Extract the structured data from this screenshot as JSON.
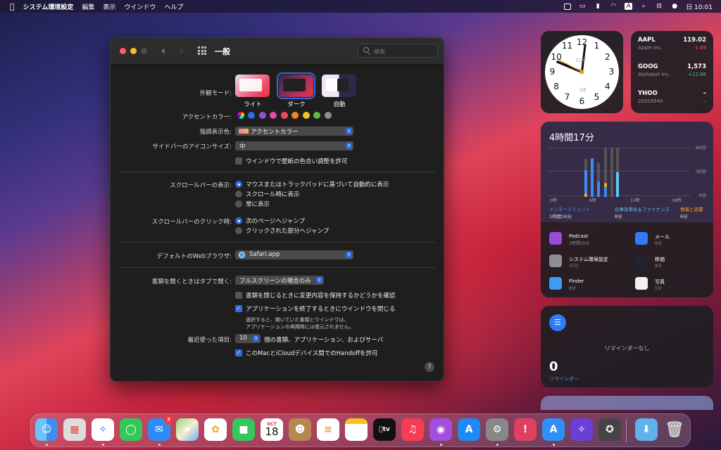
{
  "menubar": {
    "app": "システム環境設定",
    "items": [
      "編集",
      "表示",
      "ウインドウ",
      "ヘルプ"
    ],
    "clock": "日 10:01",
    "input_indicator": "A"
  },
  "window": {
    "title": "一般",
    "search_placeholder": "検索",
    "appearance": {
      "label": "外観モード:",
      "options": [
        "ライト",
        "ダーク",
        "自動"
      ],
      "selected": "ダーク"
    },
    "accent": {
      "label": "アクセントカラー:",
      "colors": [
        "#2f6ae0",
        "#8c4fd6",
        "#e04fa0",
        "#ef4a55",
        "#f3832b",
        "#f5c21b",
        "#5dbb3f",
        "#8e8e8e"
      ]
    },
    "highlight": {
      "label": "強調表示色:",
      "value": "アクセントカラー"
    },
    "sidebar_icon": {
      "label": "サイドバーのアイコンサイズ:",
      "value": "中"
    },
    "tint_checkbox": "ウインドウで壁紙の色合い調整を許可",
    "scrollbar": {
      "label": "スクロールバーの表示:",
      "options": [
        "マウスまたはトラックパッドに基づいて自動的に表示",
        "スクロール時に表示",
        "常に表示"
      ]
    },
    "scroll_click": {
      "label": "スクロールバーのクリック時:",
      "options": [
        "次のページへジャンプ",
        "クリックされた部分へジャンプ"
      ]
    },
    "browser": {
      "label": "デフォルトのWebブラウザ:",
      "value": "Safari.app"
    },
    "tabs": {
      "label": "書類を開くときはタブで開く:",
      "value": "フルスクリーンの場合のみ"
    },
    "ask_keep": "書類を閉じるときに変更内容を保持するかどうかを確認",
    "close_windows": "アプリケーションを終了するときにウインドウを閉じる",
    "close_note": [
      "選択すると、開いていた書類とウインドウは、",
      "アプリケーションの再開時には復元されません。"
    ],
    "recent": {
      "label": "最近使った項目:",
      "value": "10",
      "suffix": "個の書類、アプリケーション、およびサーバ"
    },
    "handoff": "このMacとiCloudデバイス間でのHandoffを許可",
    "help": "?"
  },
  "clock_widget": {
    "numbers": [
      "12",
      "1",
      "2",
      "3",
      "4",
      "5",
      "6",
      "7",
      "8",
      "9",
      "10",
      "11"
    ],
    "city": "CUP",
    "offset": "-16",
    "time": "10:01"
  },
  "stocks": [
    {
      "symbol": "AAPL",
      "name": "Apple Inc.",
      "price": "119.02",
      "change": "-1.69",
      "color": "#ff453a"
    },
    {
      "symbol": "GOOG",
      "name": "Alphabet Inc.",
      "price": "1,573",
      "change": "+13.88",
      "color": "#30d158"
    },
    {
      "symbol": "YHOO",
      "name": "20318540",
      "price": "–",
      "change": "–",
      "color": "#999999"
    }
  ],
  "screentime": {
    "total": "4時間17分",
    "yaxis": [
      "60分",
      "30分",
      "0分"
    ],
    "xaxis": [
      "0時",
      "6時",
      "12時",
      "18時"
    ],
    "categories": [
      {
        "name": "エンターテイメント",
        "time": "1時間16分",
        "color": "#3d8cf5"
      },
      {
        "name": "仕事効率化＆ファイナンス",
        "time": "8分",
        "color": "#5bc8f5"
      },
      {
        "name": "情報と読書",
        "time": "6分",
        "color": "#f5a623"
      }
    ],
    "apps": [
      {
        "name": "Podcast",
        "time": "1時間16分",
        "color": "#9b4bd6"
      },
      {
        "name": "メール",
        "time": "8分",
        "color": "#2f7cf6"
      },
      {
        "name": "システム環境設定",
        "time": "15分",
        "color": "#8e8e93"
      },
      {
        "name": "株価",
        "time": "8分",
        "color": "#222230"
      },
      {
        "name": "Finder",
        "time": "8分",
        "color": "#3e9cf5"
      },
      {
        "name": "写真",
        "time": "5分",
        "color": "#f2f2f2"
      }
    ]
  },
  "reminders": {
    "empty": "リマインダーなし",
    "count": "0",
    "label": "リマインダー"
  },
  "dock": {
    "mail_badge": "3",
    "calendar_month": "OCT",
    "calendar_day": "18",
    "tv_label": "tv"
  }
}
